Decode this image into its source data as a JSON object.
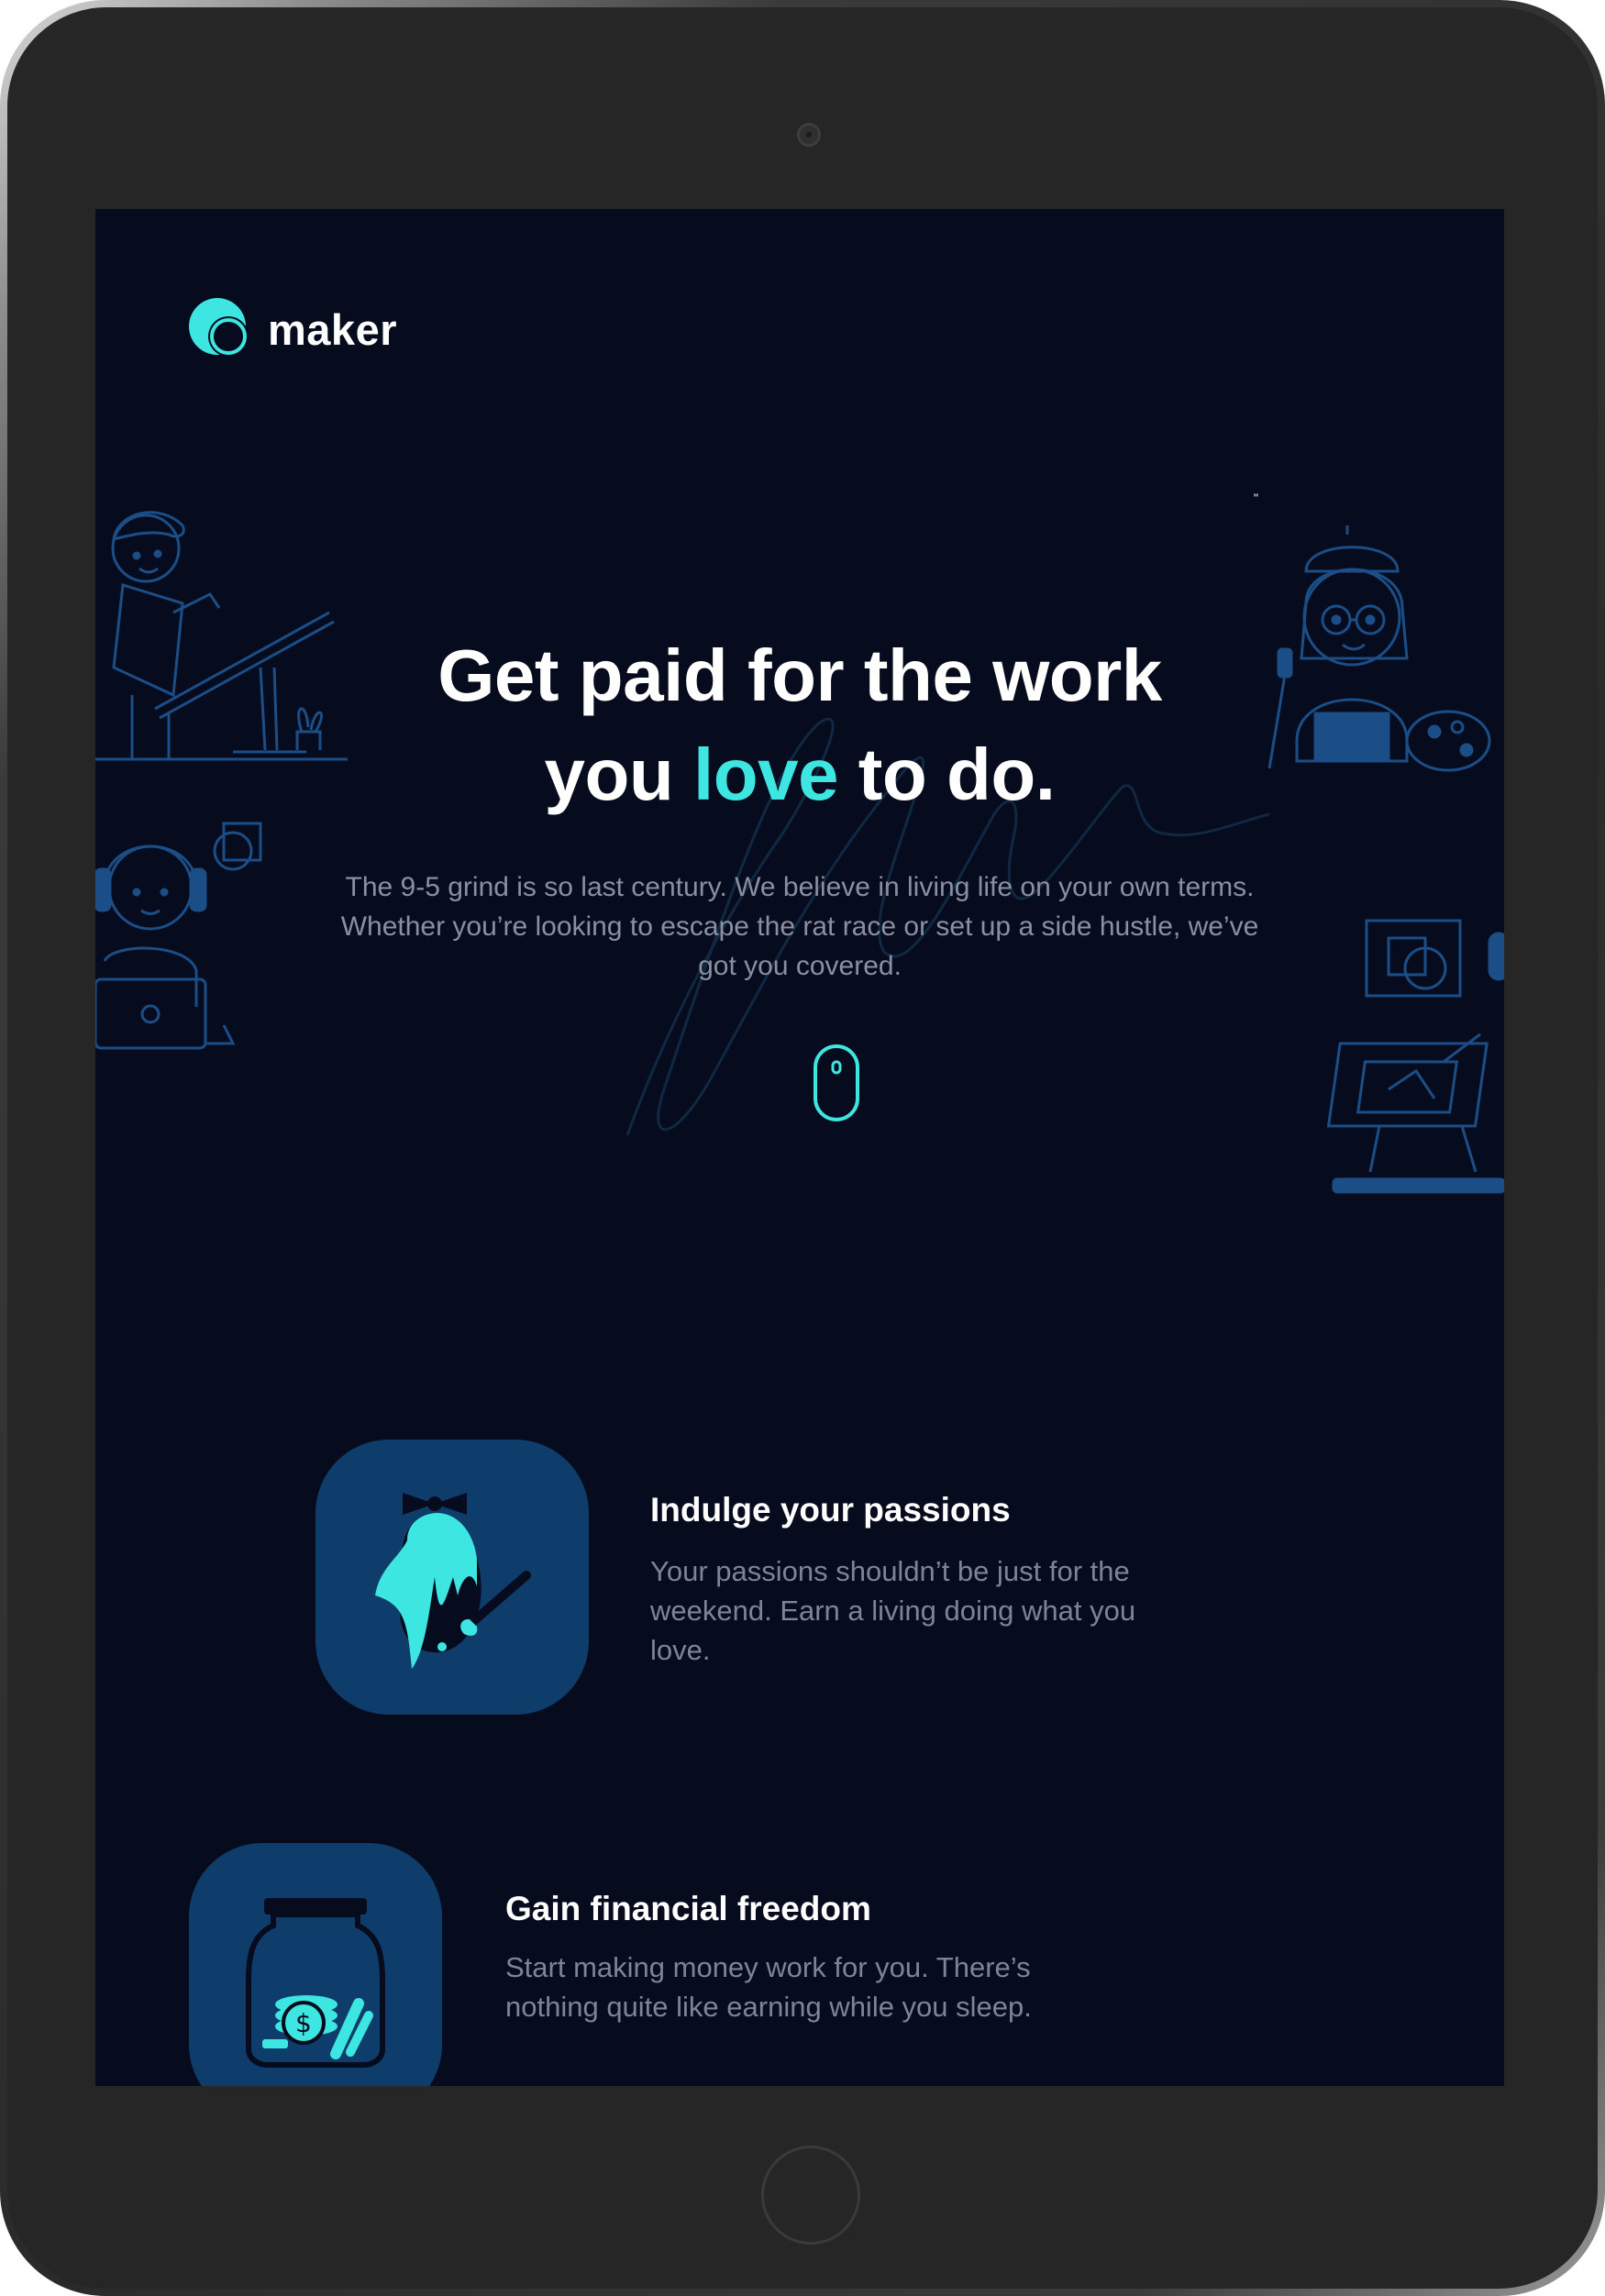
{
  "brand": {
    "name": "maker",
    "accent": "#3de6e1",
    "background": "#070b1e"
  },
  "hero": {
    "title_line1": "Get paid for the work",
    "title_pre": "you ",
    "title_accent": "love",
    "title_post": " to do.",
    "description": "The 9-5 grind is so last century. We believe in living life on your own terms. Whether you’re looking to escape the rat race or set up a side hustle, we’ve got you covered.",
    "scroll_icon": "mouse-icon"
  },
  "features": [
    {
      "icon": "paint-bucket-icon",
      "title": "Indulge your passions",
      "description": "Your passions shouldn’t be just for the weekend. Earn a living doing what you love."
    },
    {
      "icon": "money-jar-icon",
      "title": "Gain financial freedom",
      "description": "Start making money work for you. There’s nothing quite like earning while you sleep."
    }
  ]
}
